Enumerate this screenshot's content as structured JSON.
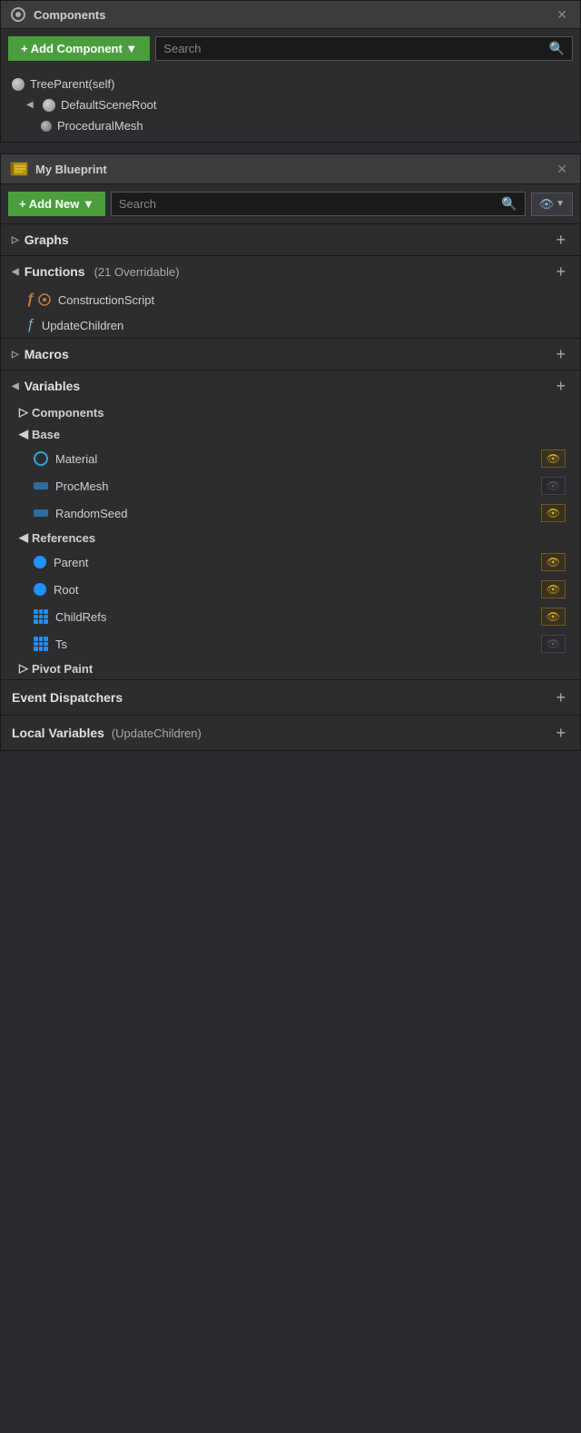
{
  "components_panel": {
    "title": "Components",
    "search_placeholder": "Search",
    "add_button_label": "+ Add Component ▼",
    "tree": [
      {
        "id": "tree-parent",
        "label": "TreeParent(self)",
        "indent": 0,
        "type": "sphere",
        "arrow": ""
      },
      {
        "id": "default-scene-root",
        "label": "DefaultSceneRoot",
        "indent": 1,
        "type": "sphere",
        "arrow": "◀"
      },
      {
        "id": "procedural-mesh",
        "label": "ProceduralMesh",
        "indent": 2,
        "type": "sphere-sm",
        "arrow": ""
      }
    ]
  },
  "blueprint_panel": {
    "title": "My Blueprint",
    "add_button_label": "+ Add New ▼",
    "search_placeholder": "Search",
    "sections": {
      "graphs": {
        "label": "Graphs",
        "expanded": false,
        "arrow": "▷"
      },
      "functions": {
        "label": "Functions",
        "subtitle": "(21 Overridable)",
        "expanded": true,
        "arrow": "◀"
      },
      "macros": {
        "label": "Macros",
        "expanded": false,
        "arrow": "▷"
      },
      "variables": {
        "label": "Variables",
        "expanded": true,
        "arrow": "◀"
      }
    },
    "functions": [
      {
        "id": "construction-script",
        "label": "ConstructionScript",
        "type": "construction"
      },
      {
        "id": "update-children",
        "label": "UpdateChildren",
        "type": "update"
      }
    ],
    "variable_groups": [
      {
        "id": "components-group",
        "label": "Components",
        "expanded": false,
        "arrow": "▷",
        "vars": []
      },
      {
        "id": "base-group",
        "label": "Base",
        "expanded": true,
        "arrow": "◀",
        "vars": [
          {
            "id": "material",
            "label": "Material",
            "icon": "circle-outline",
            "visible": true
          },
          {
            "id": "proc-mesh",
            "label": "ProcMesh",
            "icon": "rect-blue",
            "visible": false
          },
          {
            "id": "random-seed",
            "label": "RandomSeed",
            "icon": "rect-blue",
            "visible": true
          }
        ]
      },
      {
        "id": "references-group",
        "label": "References",
        "expanded": true,
        "arrow": "◀",
        "vars": [
          {
            "id": "parent",
            "label": "Parent",
            "icon": "circle-fill",
            "visible": true
          },
          {
            "id": "root",
            "label": "Root",
            "icon": "circle-fill",
            "visible": true
          },
          {
            "id": "child-refs",
            "label": "ChildRefs",
            "icon": "grid",
            "visible": true
          },
          {
            "id": "ts",
            "label": "Ts",
            "icon": "grid",
            "visible": false
          }
        ]
      },
      {
        "id": "pivot-paint-group",
        "label": "Pivot Paint",
        "expanded": false,
        "arrow": "▷",
        "vars": []
      }
    ],
    "event_dispatchers": {
      "label": "Event Dispatchers"
    },
    "local_variables": {
      "label": "Local Variables",
      "subtitle": "(UpdateChildren)"
    }
  },
  "icons": {
    "search": "🔍",
    "plus": "+",
    "eye_visible": "👁",
    "eye_hidden": "👁",
    "close": "✕"
  }
}
